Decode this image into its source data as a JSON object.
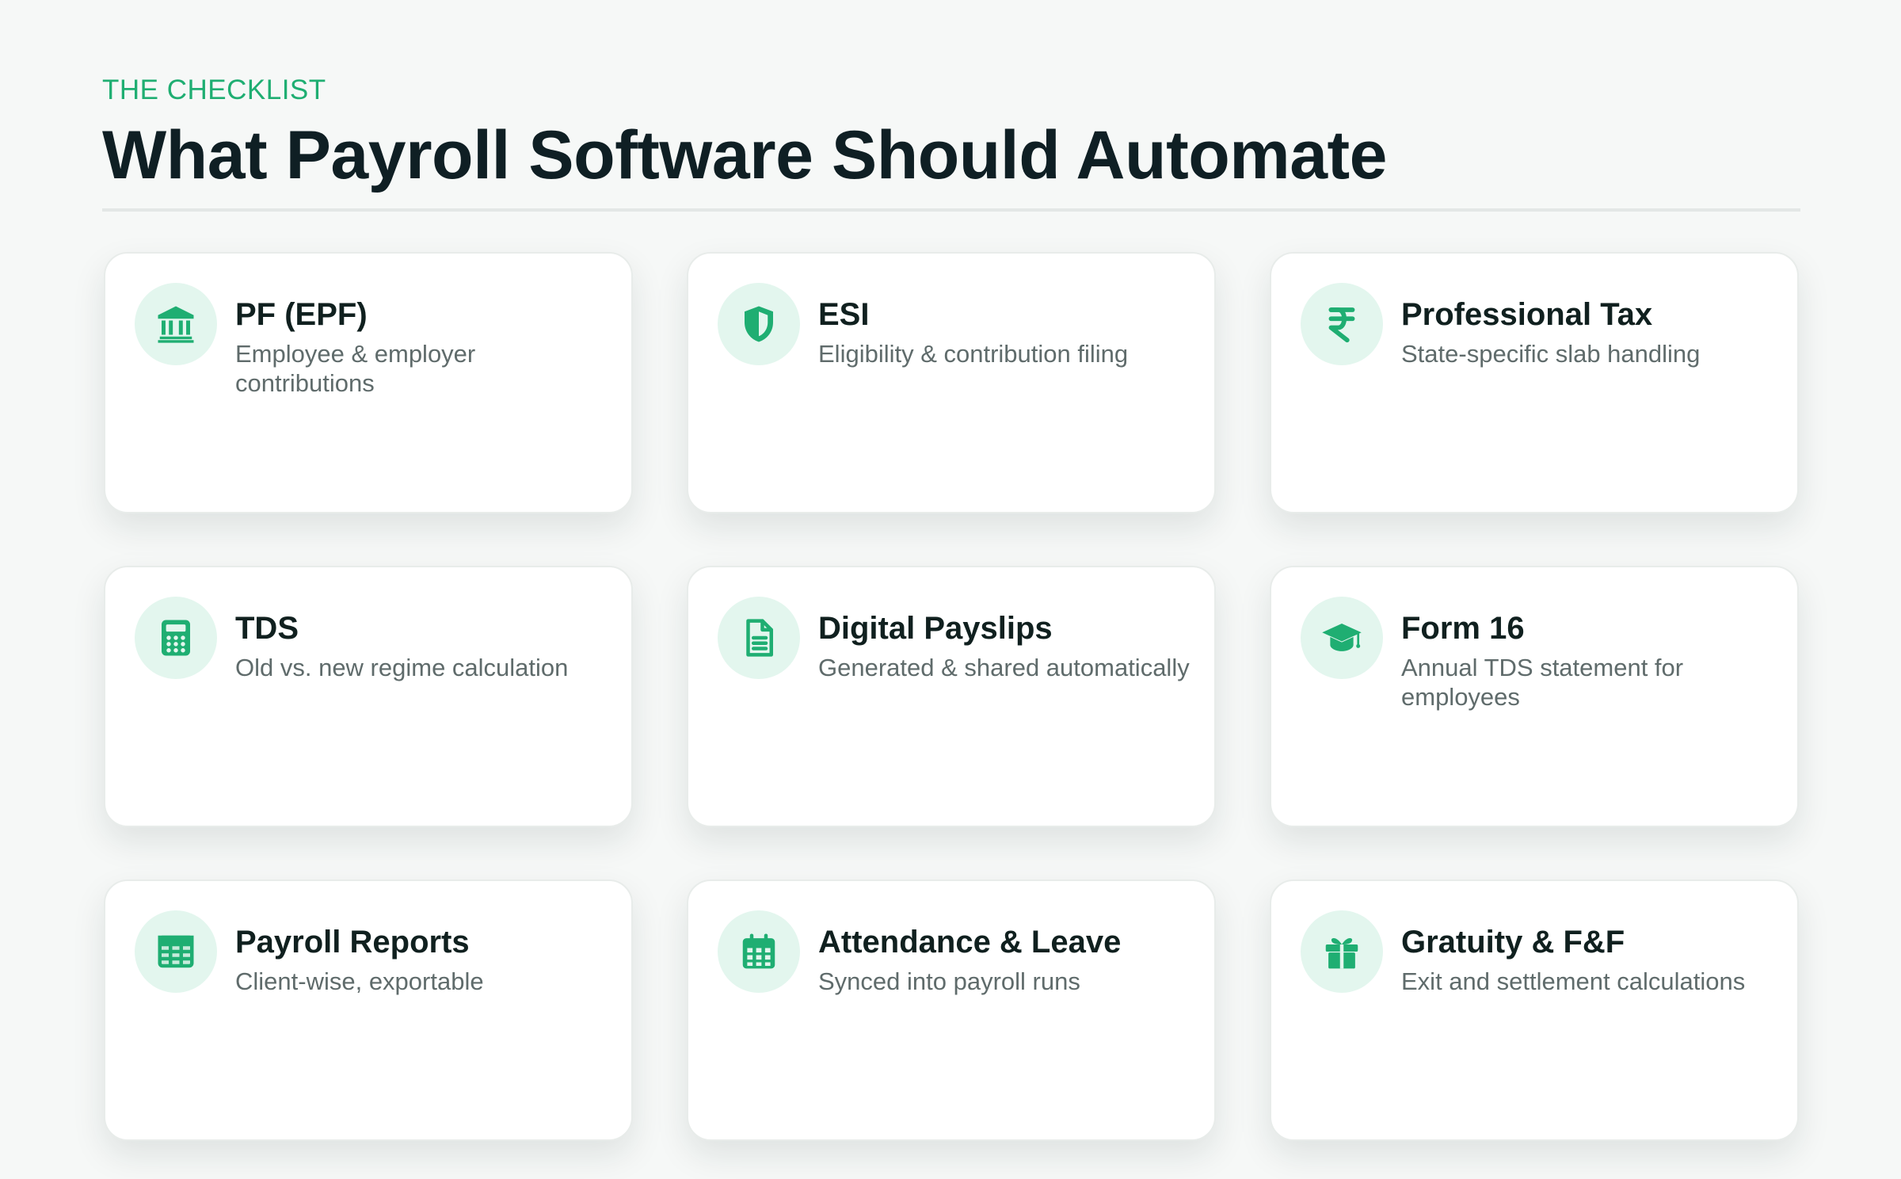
{
  "header": {
    "eyebrow": "THE CHECKLIST",
    "title": "What Payroll Software Should Automate"
  },
  "colors": {
    "accent": "#1fae72",
    "icon_bg": "#e3f6ee",
    "title": "#0f1f24",
    "body_text": "#5f6b6b",
    "page_bg": "#f6f8f7"
  },
  "cards": [
    {
      "icon": "bank-icon",
      "title": "PF (EPF)",
      "desc": "Employee & employer contributions"
    },
    {
      "icon": "shield-icon",
      "title": "ESI",
      "desc": "Eligibility & contribution filing"
    },
    {
      "icon": "rupee-icon",
      "title": "Professional Tax",
      "desc": "State-specific slab handling"
    },
    {
      "icon": "calculator-icon",
      "title": "TDS",
      "desc": "Old vs. new regime calculation"
    },
    {
      "icon": "document-icon",
      "title": "Digital Payslips",
      "desc": "Generated & shared automatically"
    },
    {
      "icon": "graduation-cap-icon",
      "title": "Form 16",
      "desc": "Annual TDS statement for employees"
    },
    {
      "icon": "table-icon",
      "title": "Payroll Reports",
      "desc": "Client-wise, exportable"
    },
    {
      "icon": "calendar-icon",
      "title": "Attendance & Leave",
      "desc": "Synced into payroll runs"
    },
    {
      "icon": "gift-icon",
      "title": "Gratuity & F&F",
      "desc": "Exit and settlement calculations"
    }
  ]
}
